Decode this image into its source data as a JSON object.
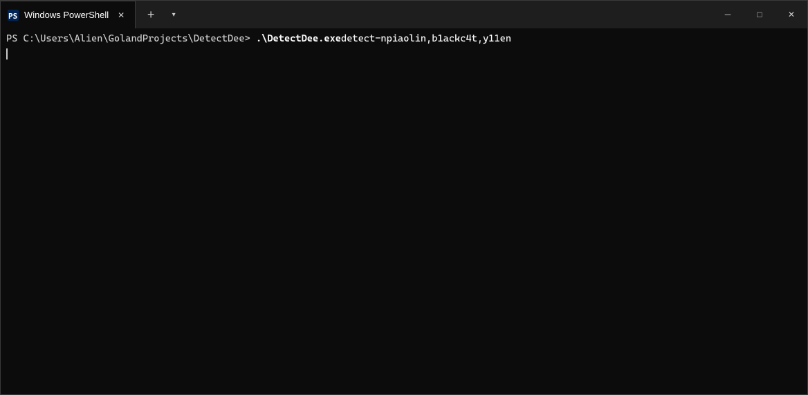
{
  "titlebar": {
    "tab_label": "Windows PowerShell",
    "new_tab_label": "+",
    "dropdown_label": "▾"
  },
  "window_controls": {
    "minimize": "─",
    "maximize": "□",
    "close": "✕"
  },
  "terminal": {
    "prompt": "PS C:\\Users\\Alien\\GolandProjects\\DetectDee> ",
    "command_exe": ".\\DetectDee.exe",
    "command_verb": " detect ",
    "command_flag": "-n ",
    "command_args": "piaolin,b1ackc4t,y11en"
  }
}
